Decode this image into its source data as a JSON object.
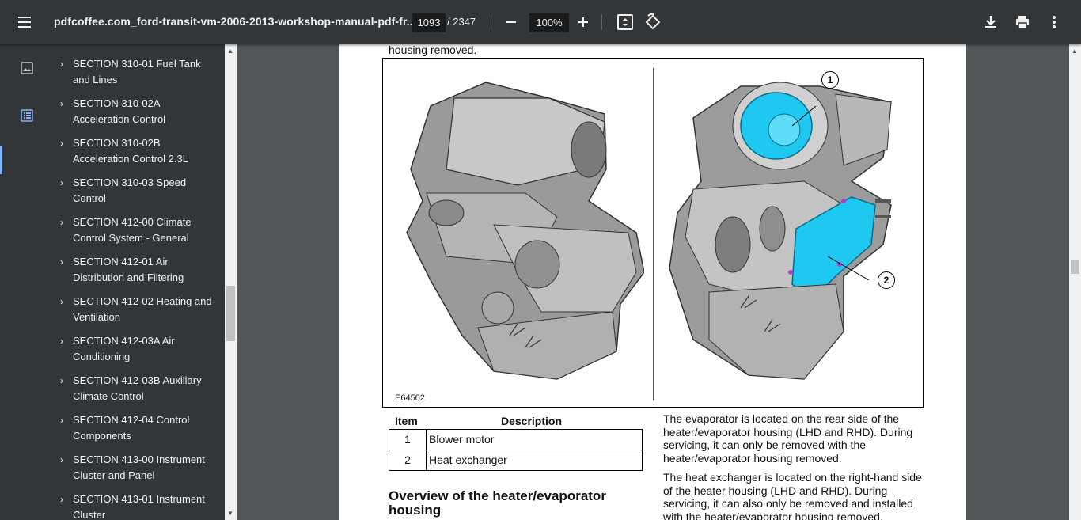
{
  "toolbar": {
    "title": "pdfcoffee.com_ford-transit-vm-2006-2013-workshop-manual-pdf-fr...",
    "current_page": "1093",
    "total_pages": "/ 2347",
    "zoom": "100%"
  },
  "outline": {
    "items": [
      {
        "label": "SECTION 310-01 Fuel Tank and Lines"
      },
      {
        "label": "SECTION 310-02A Acceleration Control"
      },
      {
        "label": "SECTION 310-02B Acceleration Control 2.3L"
      },
      {
        "label": "SECTION 310-03 Speed Control"
      },
      {
        "label": "SECTION 412-00 Climate Control System - General"
      },
      {
        "label": "SECTION 412-01 Air Distribution and Filtering"
      },
      {
        "label": "SECTION 412-02 Heating and Ventilation"
      },
      {
        "label": "SECTION 412-03A Air Conditioning"
      },
      {
        "label": "SECTION 412-03B Auxiliary Climate Control"
      },
      {
        "label": "SECTION 412-04 Control Components"
      },
      {
        "label": "SECTION 413-00 Instrument Cluster and Panel"
      },
      {
        "label": "SECTION 413-01 Instrument Cluster"
      }
    ]
  },
  "document": {
    "top_text": "housing removed.",
    "figure_id": "E64502",
    "callouts": [
      "1",
      "2"
    ],
    "table": {
      "headers": [
        "Item",
        "Description"
      ],
      "rows": [
        {
          "item": "1",
          "description": "Blower motor"
        },
        {
          "item": "2",
          "description": "Heat exchanger"
        }
      ]
    },
    "heading_line1": "Overview of the heater/evaporator",
    "heading_line2": "housing",
    "para1": "The evaporator is located on the rear side of the heater/evaporator housing (LHD and RHD). During servicing, it can only be removed with the heater/evaporator housing removed.",
    "para2": "The heat exchanger is located on the right-hand side of the heater housing (LHD and RHD). During servicing, it can also only be removed and installed with the heater/evaporator housing removed."
  },
  "colors": {
    "toolbar_bg": "#323639",
    "viewer_bg": "#525659",
    "highlight_part": "#1fc8f0",
    "active_accent": "#8ab4f8"
  }
}
